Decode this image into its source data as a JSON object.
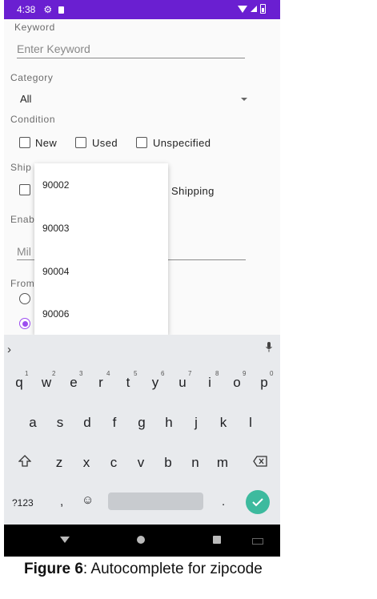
{
  "status_bar": {
    "time": "4:38"
  },
  "form": {
    "keyword": {
      "label": "Keyword",
      "placeholder": "Enter Keyword"
    },
    "category": {
      "label": "Category",
      "value": "All"
    },
    "condition": {
      "label": "Condition",
      "options": [
        "New",
        "Used",
        "Unspecified"
      ]
    },
    "shipping": {
      "label_partial": "Ship",
      "option_partial": "Shipping"
    },
    "enable": {
      "label_partial": "Enab",
      "miles_placeholder_partial": "Mil"
    },
    "from": {
      "label_partial": "From"
    }
  },
  "autocomplete": {
    "items": [
      "90002",
      "90003",
      "90004",
      "90006"
    ]
  },
  "keyboard": {
    "row1": [
      "q",
      "w",
      "e",
      "r",
      "t",
      "y",
      "u",
      "i",
      "o",
      "p"
    ],
    "row1_hints": [
      "1",
      "2",
      "3",
      "4",
      "5",
      "6",
      "7",
      "8",
      "9",
      "0"
    ],
    "row2": [
      "a",
      "s",
      "d",
      "f",
      "g",
      "h",
      "j",
      "k",
      "l"
    ],
    "row3": [
      "z",
      "x",
      "c",
      "v",
      "b",
      "n",
      "m"
    ],
    "symbols_key": "?123",
    "comma_key": ",",
    "period_key": "."
  },
  "caption": {
    "figure": "Figure 6",
    "text": ": Autocomplete for zipcode"
  },
  "colors": {
    "status_bar": "#6a1fd1",
    "radio_accent": "#9c4cf0",
    "enter_key": "#3dba9e"
  },
  "icons": [
    "settings-icon",
    "sd-card-icon",
    "wifi-icon",
    "signal-icon",
    "battery-icon",
    "chevron-right-icon",
    "microphone-icon",
    "shift-icon",
    "backspace-icon",
    "emoji-icon",
    "check-icon",
    "back-icon",
    "home-icon",
    "recents-icon",
    "keyboard-icon"
  ]
}
